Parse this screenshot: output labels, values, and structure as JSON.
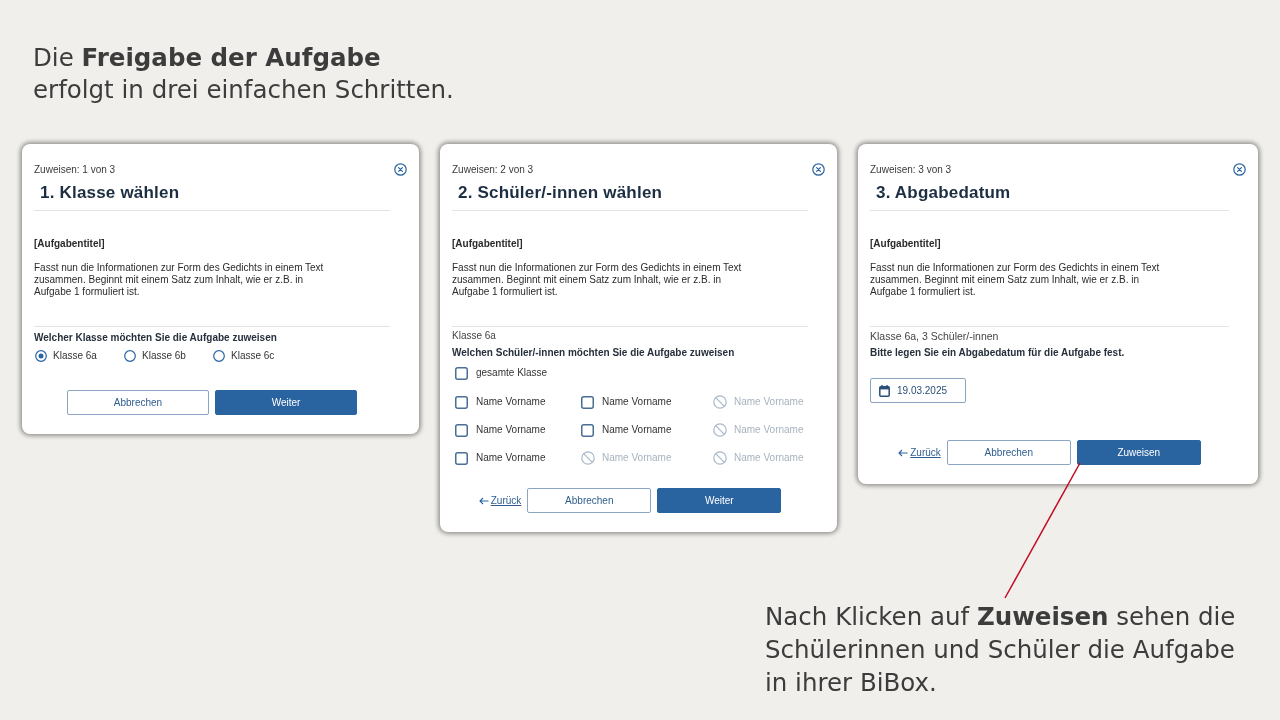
{
  "intro": {
    "lines": [
      "Die **Freigabe der Aufgabe**",
      "erfolgt in drei einfachen Schritten."
    ]
  },
  "dialogs": [
    {
      "kind": "class",
      "step_label": "Zuweisen: 1 von 3",
      "title": "1. Klasse wählen",
      "task_title": "[Aufgabentitel]",
      "task_text": "Fasst nun die Informationen zur Form des Gedichts in einem Text zusammen. Beginnt mit einem Satz zum Inhalt, wie er z.B. in Aufgabe 1 formuliert ist.",
      "question": "Welcher Klasse möchten Sie die Aufgabe zuweisen",
      "options": [
        {
          "label": "Klasse 6a",
          "selected": true
        },
        {
          "label": "Klasse 6b",
          "selected": false
        },
        {
          "label": "Klasse 6c",
          "selected": false
        }
      ],
      "actions": [
        {
          "kind": "secondary",
          "label": "Abbrechen"
        },
        {
          "kind": "primary",
          "label": "Weiter"
        }
      ]
    },
    {
      "kind": "students",
      "step_label": "Zuweisen: 2 von 3",
      "title": "2. Schüler/-innen wählen",
      "task_title": "[Aufgabentitel]",
      "task_text": "Fasst nun die Informationen zur Form des Gedichts in einem Text zusammen. Beginnt mit einem Satz zum Inhalt, wie er z.B. in Aufgabe 1 formuliert ist.",
      "class_label": "Klasse 6a",
      "question": "Welchen Schüler/-innen möchten Sie die Aufgabe zuweisen",
      "whole_class": {
        "label": "gesamte Klasse",
        "checked": false
      },
      "students": [
        {
          "label": "Name Vorname",
          "checked": false,
          "disabled": false
        },
        {
          "label": "Name Vorname",
          "checked": false,
          "disabled": false
        },
        {
          "label": "Name Vorname",
          "checked": false,
          "disabled": true
        },
        {
          "label": "Name Vorname",
          "checked": false,
          "disabled": false
        },
        {
          "label": "Name Vorname",
          "checked": false,
          "disabled": false
        },
        {
          "label": "Name Vorname",
          "checked": false,
          "disabled": true
        },
        {
          "label": "Name Vorname",
          "checked": false,
          "disabled": false
        },
        {
          "label": "Name Vorname",
          "checked": false,
          "disabled": true
        },
        {
          "label": "Name Vorname",
          "checked": false,
          "disabled": true
        }
      ],
      "actions": [
        {
          "kind": "link",
          "label": "Zurück"
        },
        {
          "kind": "secondary",
          "label": "Abbrechen"
        },
        {
          "kind": "primary",
          "label": "Weiter"
        }
      ]
    },
    {
      "kind": "date",
      "step_label": "Zuweisen: 3 von 3",
      "title": "3. Abgabedatum",
      "task_title": "[Aufgabentitel]",
      "task_text": "Fasst nun die Informationen zur Form des Gedichts in einem Text zusammen. Beginnt mit einem Satz zum Inhalt, wie er z.B. in Aufgabe 1 formuliert ist.",
      "summary": "Klasse 6a, 3 Schüler/-innen",
      "question": "Bitte legen Sie ein Abgabedatum für die Aufgabe fest.",
      "date": {
        "value": "19.03.2025"
      },
      "actions": [
        {
          "kind": "link",
          "label": "Zurück"
        },
        {
          "kind": "secondary",
          "label": "Abbrechen"
        },
        {
          "kind": "primary",
          "label": "Zuweisen"
        }
      ]
    }
  ],
  "callout": {
    "lines": [
      "Nach Klicken auf **Zuweisen** sehen die",
      "Schülerinnen und Schüler die Aufgabe",
      "in ihrer BiBox."
    ]
  }
}
